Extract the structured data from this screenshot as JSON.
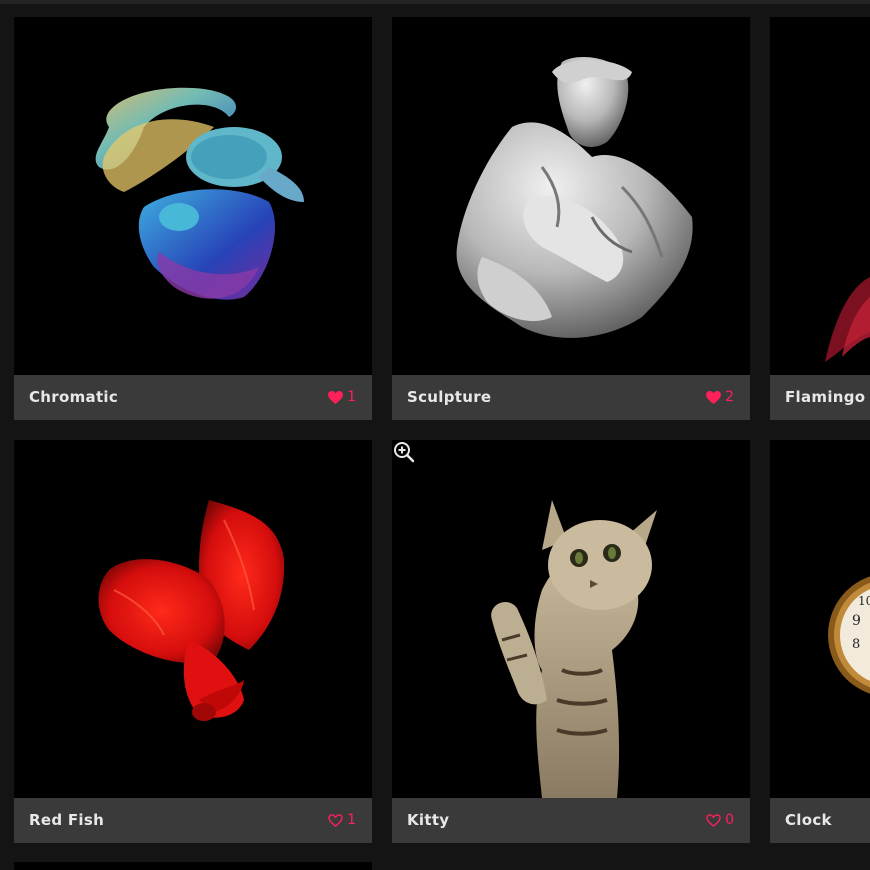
{
  "gallery": {
    "items": [
      {
        "title": "Chromatic",
        "likes": "1",
        "liked": true
      },
      {
        "title": "Sculpture",
        "likes": "2",
        "liked": true
      },
      {
        "title": "Flamingo",
        "likes": "",
        "liked": false
      },
      {
        "title": "Red Fish",
        "likes": "1",
        "liked": false
      },
      {
        "title": "Kitty",
        "likes": "0",
        "liked": false
      },
      {
        "title": "Clock",
        "likes": "",
        "liked": false
      }
    ]
  },
  "colors": {
    "background": "#141414",
    "caption_bg": "#3a3a3a",
    "accent_heart": "#ff1f5a",
    "title_text": "#e8e8e8"
  },
  "icons": [
    "heart-filled-icon",
    "heart-outline-icon",
    "zoom-in-icon"
  ]
}
